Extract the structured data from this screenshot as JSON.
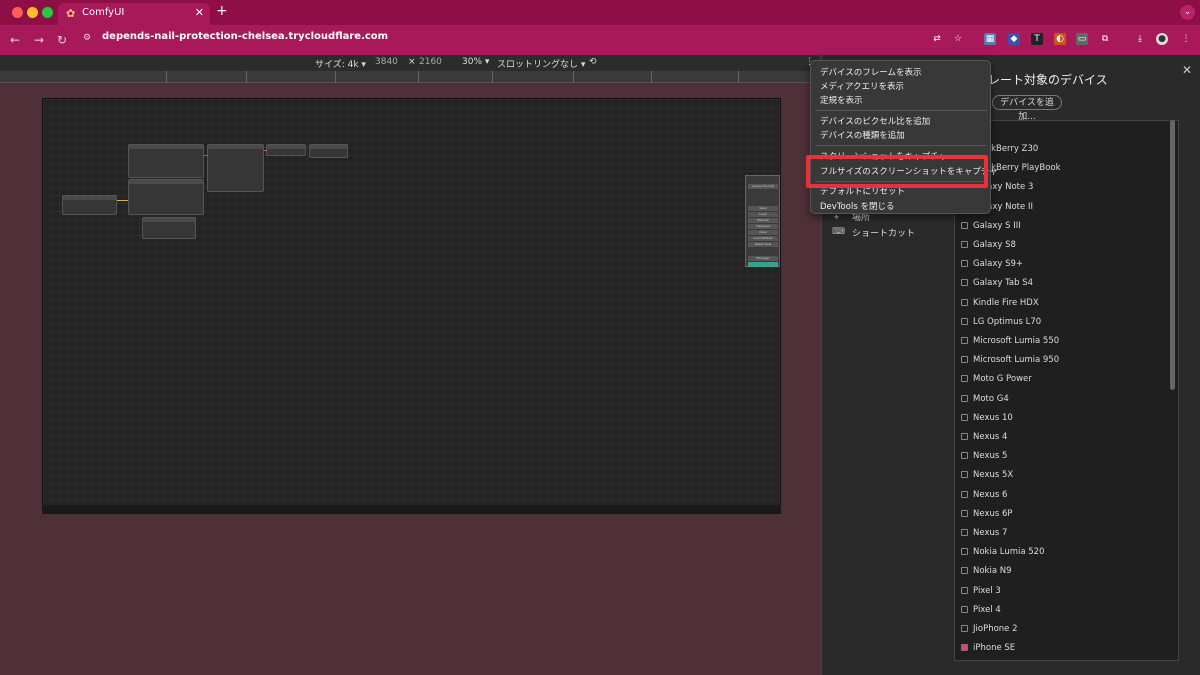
{
  "browser": {
    "tab_title": "ComfyUI",
    "tab_close": "✕",
    "new_tab": "+",
    "url": "depends-nail-protection-chelsea.trycloudflare.com"
  },
  "device_toolbar": {
    "size_label": "サイズ: 4k ▾",
    "width": "3840",
    "times": "×",
    "height": "2160",
    "zoom": "30% ▾",
    "throttle": "スロットリングなし ▾",
    "more": "⋮"
  },
  "context_menu": {
    "items": [
      "デバイスのフレームを表示",
      "メディアクエリを表示",
      "定規を表示",
      "デバイスのピクセル比を追加",
      "デバイスの種類を追加",
      "スクリーンショットをキャプチャ",
      "フルサイズのスクリーンショットをキャプチャ",
      "デフォルトにリセット",
      "DevTools を閉じる"
    ]
  },
  "settings_panel": {
    "title": "レート対象のデバイス",
    "close": "✕",
    "add_device": "デバイスを追加...",
    "side_item_partial": "場所",
    "side_item_shortcuts": "ショートカット",
    "devices": [
      {
        "name": "BlackBerry Z30",
        "checked": false
      },
      {
        "name": "BlackBerry PlayBook",
        "checked": false
      },
      {
        "name": "Galaxy Note 3",
        "checked": false
      },
      {
        "name": "Galaxy Note II",
        "checked": false
      },
      {
        "name": "Galaxy S III",
        "checked": false
      },
      {
        "name": "Galaxy S8",
        "checked": false
      },
      {
        "name": "Galaxy S9+",
        "checked": false
      },
      {
        "name": "Galaxy Tab S4",
        "checked": false
      },
      {
        "name": "Kindle Fire HDX",
        "checked": false
      },
      {
        "name": "LG Optimus L70",
        "checked": false
      },
      {
        "name": "Microsoft Lumia 550",
        "checked": false
      },
      {
        "name": "Microsoft Lumia 950",
        "checked": false
      },
      {
        "name": "Moto G Power",
        "checked": false
      },
      {
        "name": "Moto G4",
        "checked": false
      },
      {
        "name": "Nexus 10",
        "checked": false
      },
      {
        "name": "Nexus 4",
        "checked": false
      },
      {
        "name": "Nexus 5",
        "checked": false
      },
      {
        "name": "Nexus 5X",
        "checked": false
      },
      {
        "name": "Nexus 6",
        "checked": false
      },
      {
        "name": "Nexus 6P",
        "checked": false
      },
      {
        "name": "Nexus 7",
        "checked": false
      },
      {
        "name": "Nokia Lumia 520",
        "checked": false
      },
      {
        "name": "Nokia N9",
        "checked": false
      },
      {
        "name": "Pixel 3",
        "checked": false
      },
      {
        "name": "Pixel 4",
        "checked": false
      },
      {
        "name": "JioPhone 2",
        "checked": false
      },
      {
        "name": "iPhone SE",
        "checked": true
      }
    ]
  },
  "comfy_panel": {
    "buttons": [
      "Queue Prompt",
      "Save",
      "Load",
      "Refresh",
      "Clipspace",
      "Clear",
      "Load Default",
      "Reset View",
      "Manager"
    ]
  },
  "colors": {
    "tab_strip": "#8e0f45",
    "toolbar": "#a8195a",
    "highlight": "#e8323a"
  }
}
